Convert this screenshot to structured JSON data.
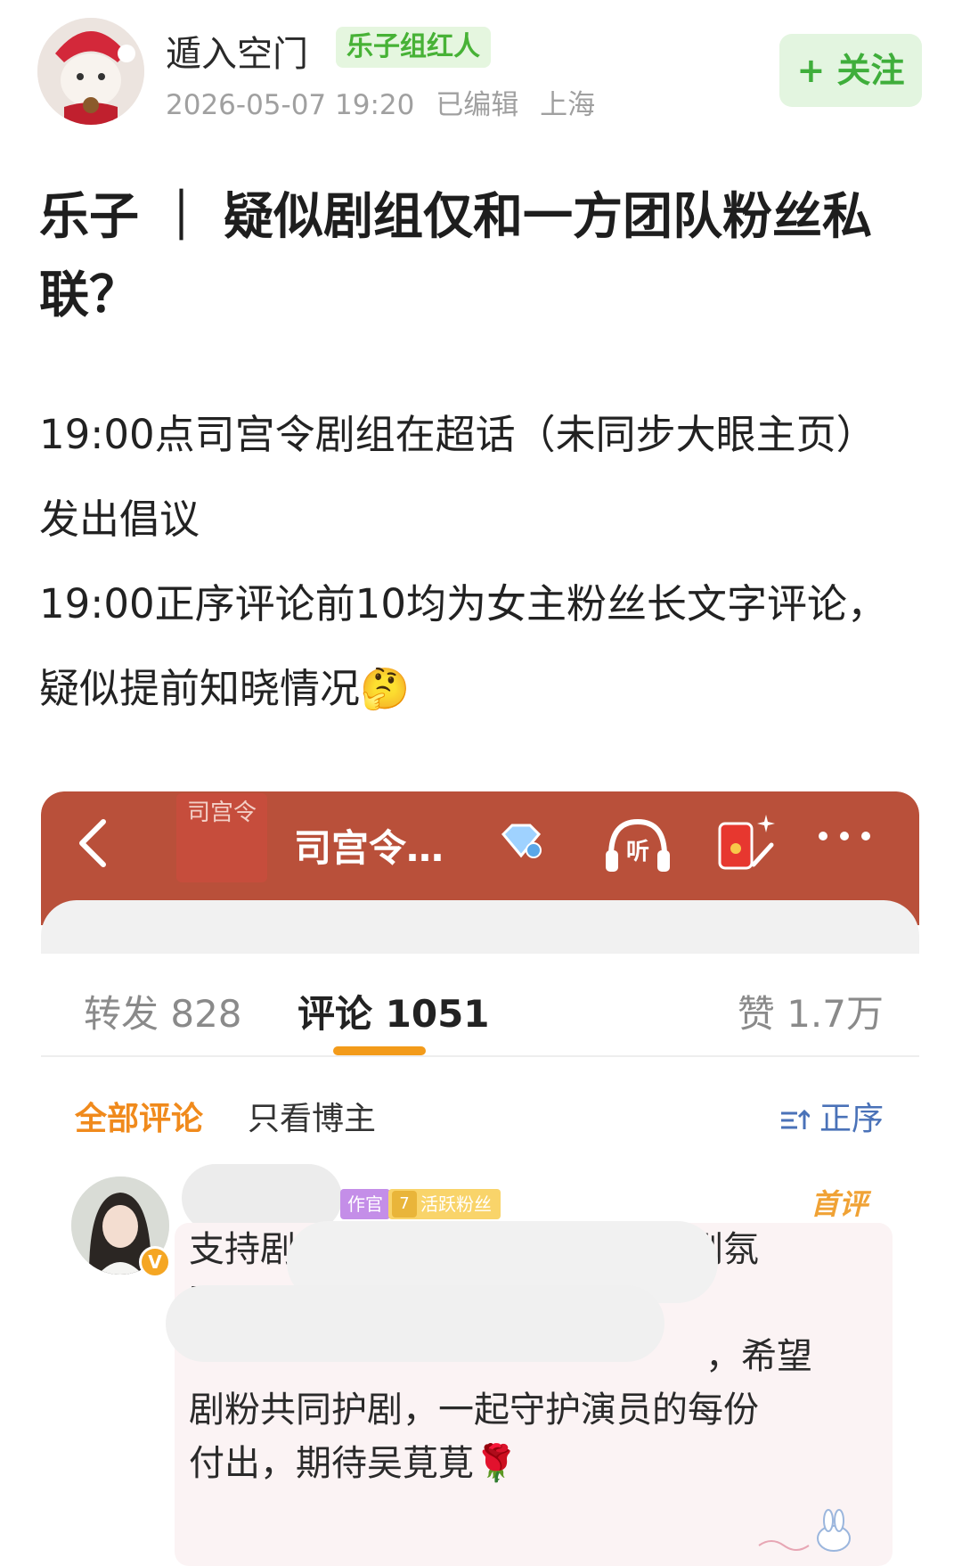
{
  "header": {
    "username": "遁入空门",
    "badge": "乐子组红人",
    "meta": {
      "date": "2026-05-07 19:20",
      "edited": "已编辑",
      "location": "上海"
    },
    "follow_label": "+ 关注"
  },
  "post": {
    "title": "乐子 ｜ 疑似剧组仅和一方团队粉丝私联？",
    "body_lines": [
      "19:00点司宫令剧组在超话（未同步大眼主页）发出倡议",
      "19:00正序评论前10均为女主粉丝长文字评论，疑似提前知晓情况🤔"
    ]
  },
  "embed": {
    "cover_text": "司宫令",
    "topic_title": "司宫令…",
    "listen_label": "听",
    "tabs": {
      "repost": "转发 828",
      "comment": "评论 1051",
      "like": "赞 1.7万"
    },
    "filters": {
      "all": "全部评论",
      "owner_only": "只看博主",
      "sort": "正序"
    },
    "comment": {
      "role_tag": "作官",
      "fan_level": "7",
      "fan_tag": "活跃粉丝",
      "first_label": "首评",
      "text_lines": [
        "支持剧方还应办剧粉一个清朗追剧氛",
        "围，",
        "，希望",
        "剧粉共同护剧，一起守护演员的每份",
        "付出，期待吴莧莧🌹"
      ]
    }
  },
  "colors": {
    "accent_orange": "#f08a1c",
    "header_red": "#b9503a",
    "follow_green": "#3fae3b"
  },
  "icons": [
    "back-arrow-icon",
    "diamond-icon",
    "headphones-icon",
    "red-packet-icon",
    "more-icon",
    "sort-icon",
    "verified-icon"
  ]
}
